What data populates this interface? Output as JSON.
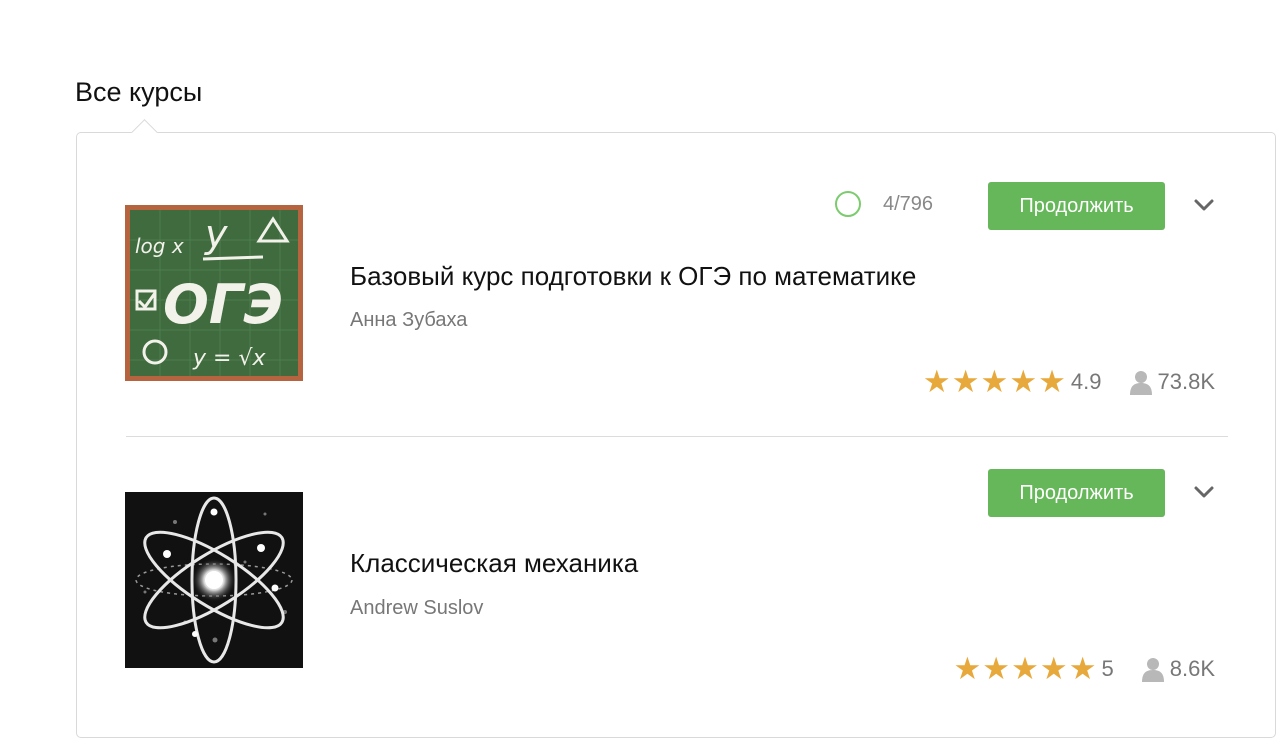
{
  "section": {
    "title": "Все курсы"
  },
  "courses": [
    {
      "title": "Базовый курс подготовки к ОГЭ по математике",
      "author": "Анна Зубаха",
      "progress": "4/796",
      "progress_fraction": 0.005,
      "continue_label": "Продолжить",
      "rating": "4.9",
      "learners": "73.8K",
      "thumbnail_text": [
        "log x",
        "у",
        "ОГЭ",
        "у = √x"
      ],
      "thumbnail_icon": "chalkboard-icon"
    },
    {
      "title": "Классическая механика",
      "author": "Andrew Suslov",
      "continue_label": "Продолжить",
      "rating": "5",
      "learners": "8.6K",
      "thumbnail_icon": "atom-icon"
    }
  ],
  "colors": {
    "accent_green": "#66b75a",
    "progress_green": "#7ccb6e",
    "star_gold": "#e8a93c"
  }
}
